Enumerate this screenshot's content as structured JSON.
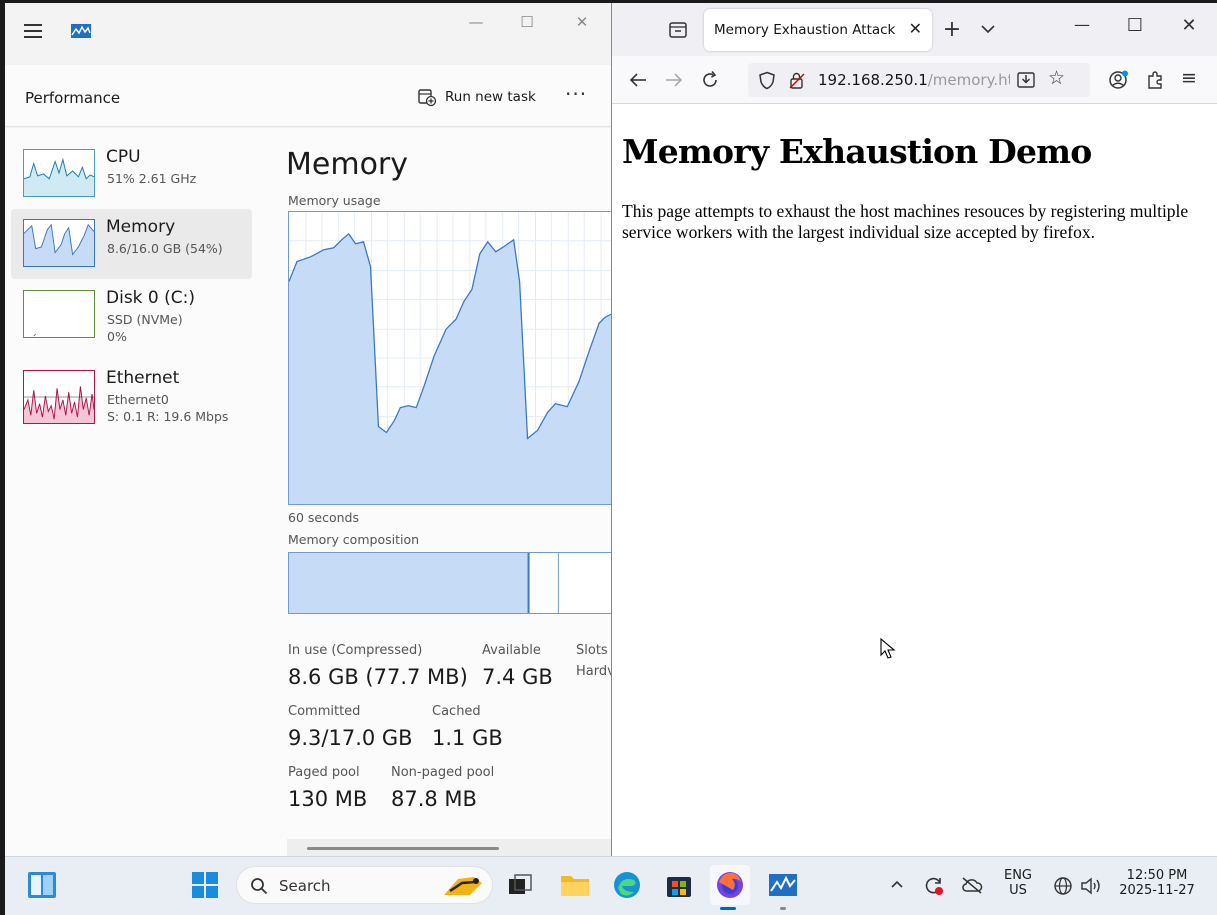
{
  "task_manager": {
    "header_title": "Performance",
    "run_task_label": "Run new task",
    "more_label": "···",
    "sidebar": [
      {
        "name": "CPU",
        "line1": "51%  2.61 GHz",
        "line2": ""
      },
      {
        "name": "Memory",
        "line1": "8.6/16.0 GB (54%)",
        "line2": ""
      },
      {
        "name": "Disk 0 (C:)",
        "line1": "SSD (NVMe)",
        "line2": "0%"
      },
      {
        "name": "Ethernet",
        "line1": "Ethernet0",
        "line2": "S: 0.1  R: 19.6 Mbps"
      }
    ],
    "main": {
      "heading": "Memory",
      "usage_label": "Memory usage",
      "time_label": "60 seconds",
      "composition_label": "Memory composition",
      "stats": {
        "in_use_label": "In use (Compressed)",
        "in_use_value": "8.6 GB (77.7 MB)",
        "available_label": "Available",
        "available_value": "7.4 GB",
        "slots_label": "Slots",
        "hardware_label": "Hardv",
        "committed_label": "Committed",
        "committed_value": "9.3/17.0 GB",
        "cached_label": "Cached",
        "cached_value": "1.1 GB",
        "paged_label": "Paged pool",
        "paged_value": "130 MB",
        "nonpaged_label": "Non-paged pool",
        "nonpaged_value": "87.8 MB"
      }
    }
  },
  "firefox": {
    "tab_title": "Memory Exhaustion Attack",
    "url_host": "192.168.250.1",
    "url_path": "/memory.htm",
    "page_heading": "Memory Exhaustion Demo",
    "page_text": "This page attempts to exhaust the host machines resouces by registering multiple service workers with the largest individual size accepted by firefox."
  },
  "taskbar": {
    "search_label": "Search",
    "lang_line1": "ENG",
    "lang_line2": "US",
    "time": "12:50 PM",
    "date": "2025-11-27"
  },
  "colors": {
    "graph_fill": "#c6dcf6",
    "graph_line": "#3b78c4",
    "ethernet_line": "#b0144a",
    "accent": "#0067c0"
  }
}
